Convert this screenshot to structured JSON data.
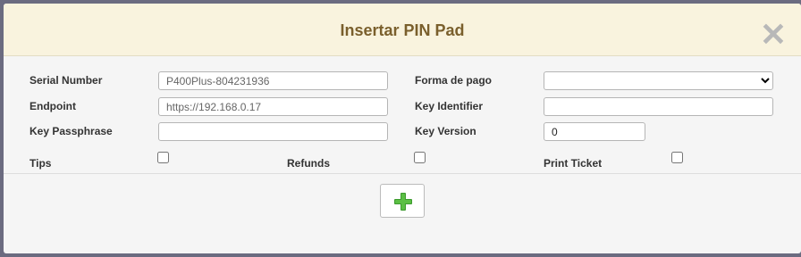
{
  "dialog": {
    "title": "Insertar PIN Pad",
    "close_glyph": "✕"
  },
  "form": {
    "serial_number": {
      "label": "Serial Number",
      "value": "P400Plus-804231936"
    },
    "endpoint": {
      "label": "Endpoint",
      "value": "https://192.168.0.17"
    },
    "key_passphrase": {
      "label": "Key Passphrase",
      "value": ""
    },
    "forma_de_pago": {
      "label": "Forma de pago",
      "selected": ""
    },
    "key_identifier": {
      "label": "Key Identifier",
      "value": ""
    },
    "key_version": {
      "label": "Key Version",
      "value": "0"
    },
    "tips": {
      "label": "Tips",
      "checked": false
    },
    "refunds": {
      "label": "Refunds",
      "checked": false
    },
    "print_ticket": {
      "label": "Print Ticket",
      "checked": false
    }
  },
  "actions": {
    "add_icon": "plus-icon",
    "add_color": "#3d9b2f"
  }
}
